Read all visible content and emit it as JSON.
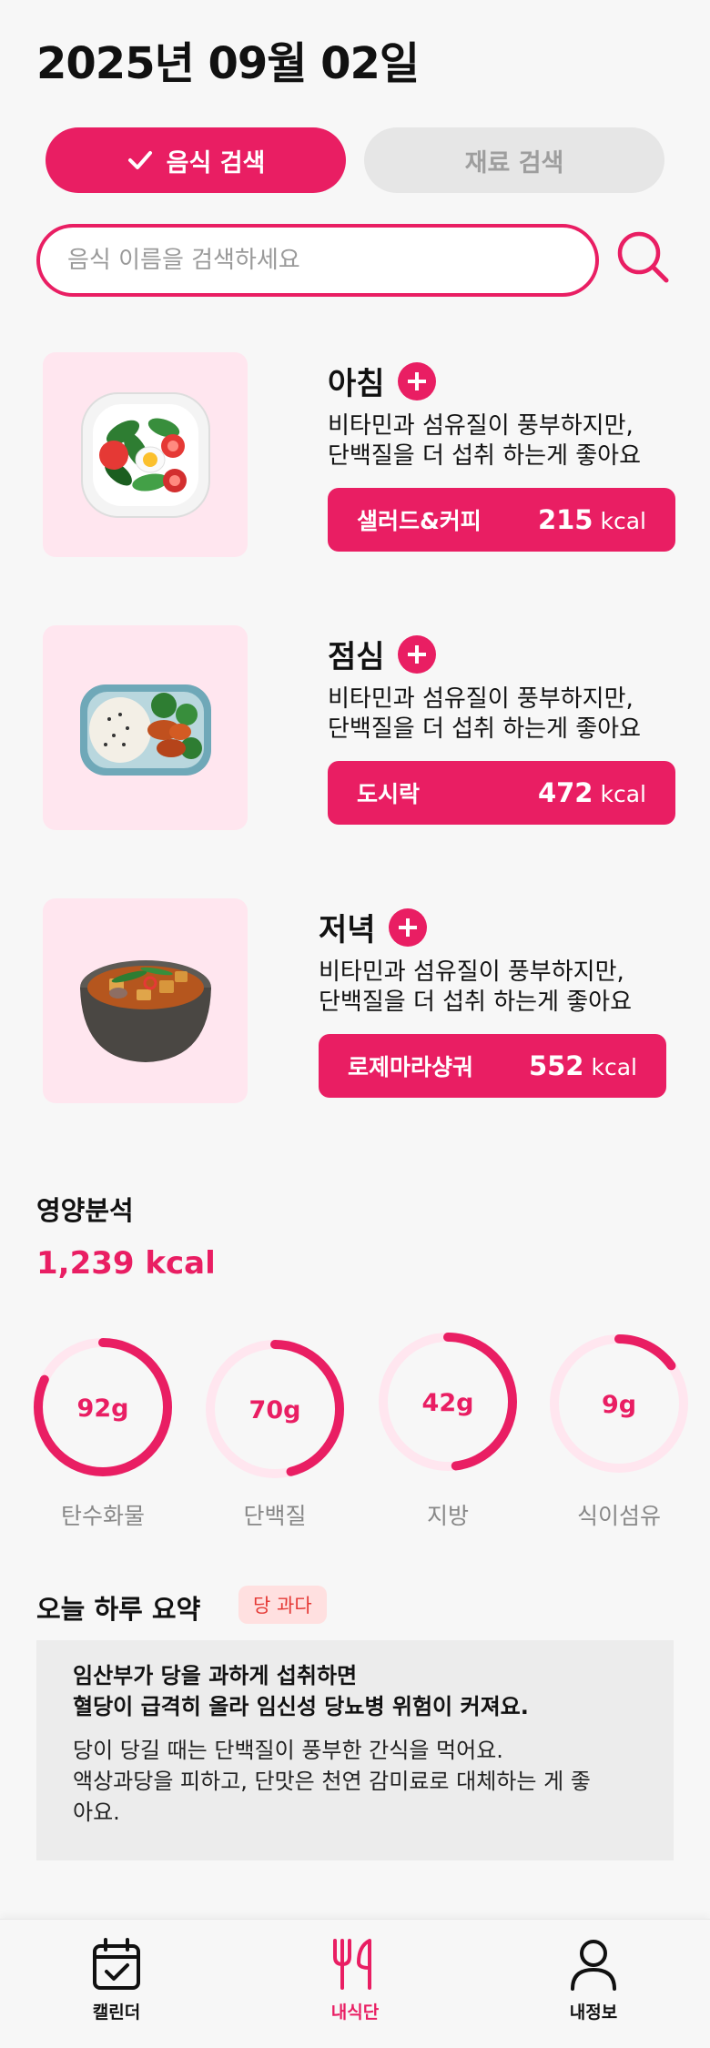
{
  "header": {
    "date": "2025년 09월 02일"
  },
  "tabs": {
    "food_search": "음식 검색",
    "ingredient_search": "재료 검색"
  },
  "search": {
    "placeholder": "음식 이름을 검색하세요"
  },
  "meals": [
    {
      "title": "아침",
      "desc_line1": "비타민과 섬유질이 풍부하지만,",
      "desc_line2": "단백질을 더 섭취 하는게 좋아요",
      "food": "샐러드&커피",
      "kcal": "215",
      "unit": "kcal",
      "image": "salad-plate"
    },
    {
      "title": "점심",
      "desc_line1": "비타민과 섬유질이 풍부하지만,",
      "desc_line2": "단백질을 더 섭취 하는게 좋아요",
      "food": "도시락",
      "kcal": "472",
      "unit": "kcal",
      "image": "lunch-box"
    },
    {
      "title": "저녁",
      "desc_line1": "비타민과 섬유질이 풍부하지만,",
      "desc_line2": "단백질을 더 섭취 하는게 좋아요",
      "food": "로제마라샹궈",
      "kcal": "552",
      "unit": "kcal",
      "image": "stew-pot"
    }
  ],
  "nutrition": {
    "title": "영양분석",
    "total_kcal": "1,239 kcal",
    "items": [
      {
        "value": "92g",
        "label": "탄수화물",
        "fraction": 0.82
      },
      {
        "value": "70g",
        "label": "단백질",
        "fraction": 0.46
      },
      {
        "value": "42g",
        "label": "지방",
        "fraction": 0.48
      },
      {
        "value": "9g",
        "label": "식이섬유",
        "fraction": 0.15
      }
    ]
  },
  "summary": {
    "title": "오늘 하루 요약",
    "badge": "당 과다",
    "head_line1": "임산부가 당을 과하게 섭취하면",
    "head_line2": "혈당이 급격히 올라 임신성 당뇨병 위험이 커져요.",
    "body_line1": "당이 당길 때는 단백질이 풍부한 간식을 먹어요.",
    "body_line2": "액상과당을 피하고, 단맛은 천연 감미료로 대체하는 게 좋",
    "body_line3": "아요."
  },
  "nav": {
    "calendar": "캘린더",
    "my_meal": "내식단",
    "my_info": "내정보"
  },
  "colors": {
    "accent": "#e91e63",
    "accent_light": "#ffe6ef",
    "badge_bg": "#ffe0e0"
  },
  "icons": [
    "check-icon",
    "search-icon",
    "plus-icon",
    "calendar-icon",
    "fork-knife-icon",
    "person-icon"
  ]
}
